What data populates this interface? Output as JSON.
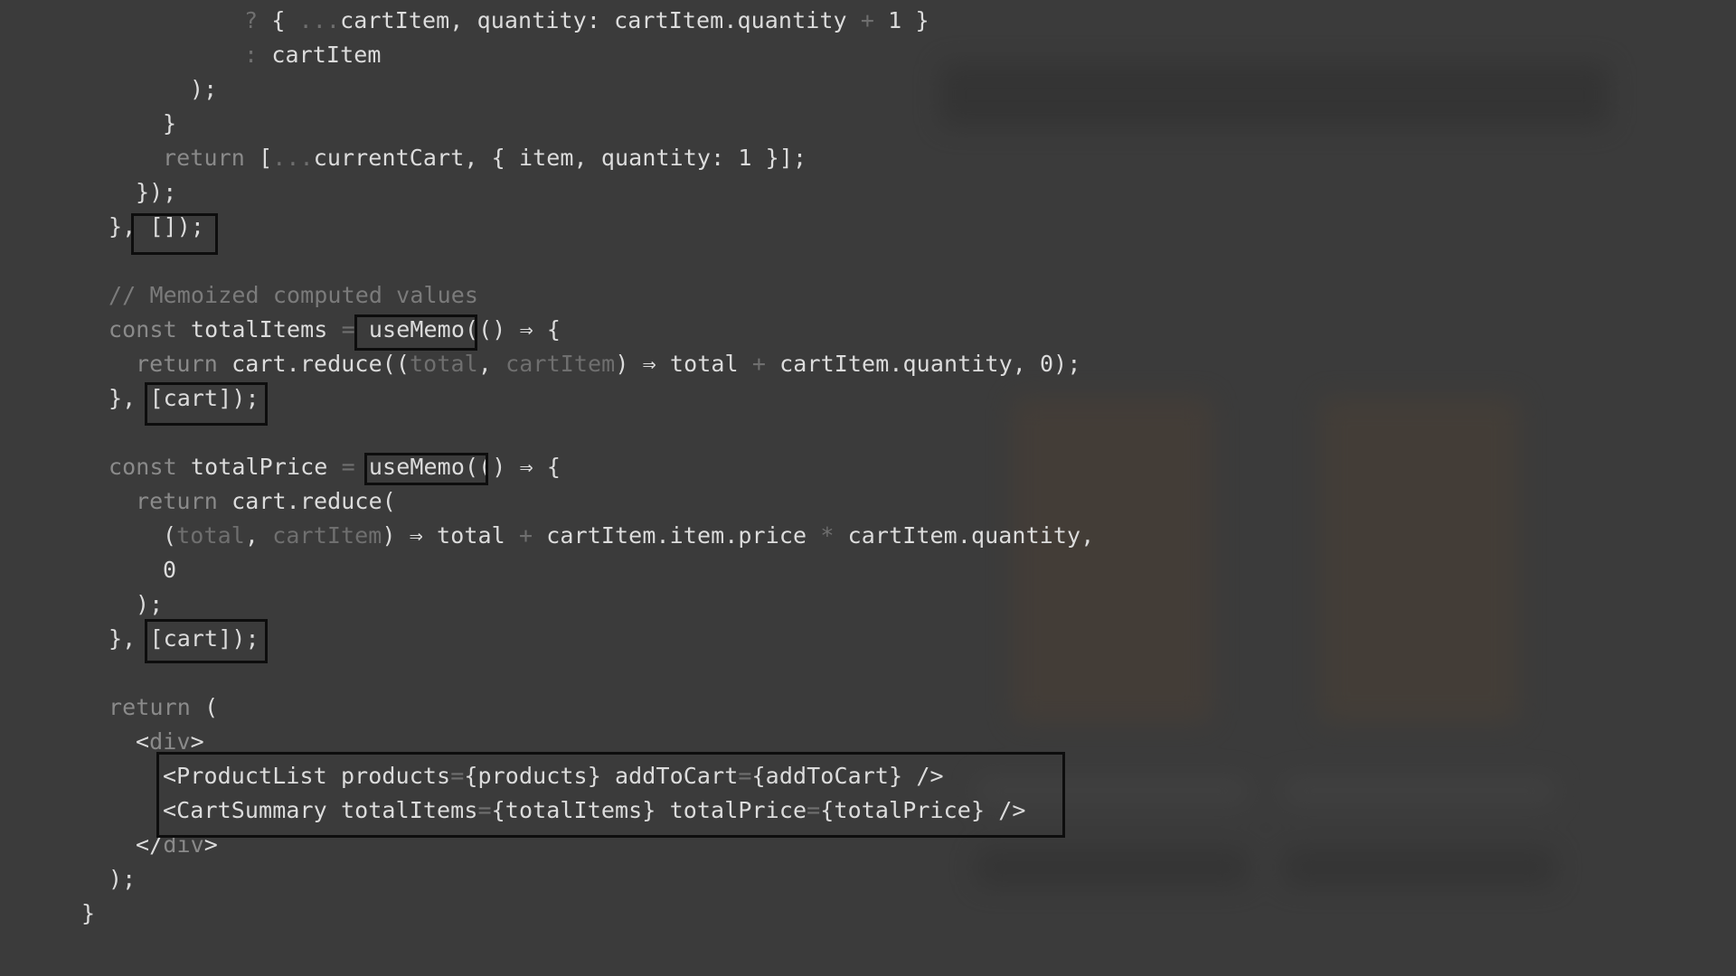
{
  "editor": {
    "language": "jsx",
    "colors": {
      "background": "#3b3b3b",
      "text": "#dcdcdc",
      "keyword": "#8a8a8a",
      "dim": "#6f6f6f",
      "highlight_border": "#0d0d0d"
    },
    "lines": [
      [
        {
          "t": "? ",
          "c": "dim"
        },
        {
          "t": "{ ",
          "c": "txt"
        },
        {
          "t": "...",
          "c": "dim"
        },
        {
          "t": "cartItem, quantity: cartItem.quantity ",
          "c": "txt"
        },
        {
          "t": "+",
          "c": "dim"
        },
        {
          "t": " 1 }",
          "c": "txt"
        }
      ],
      [
        {
          "t": ": ",
          "c": "dim"
        },
        {
          "t": "cartItem",
          "c": "txt"
        }
      ],
      [
        {
          "t": ");",
          "c": "txt"
        }
      ],
      [
        {
          "t": "}",
          "c": "txt"
        }
      ],
      [
        {
          "t": "return ",
          "c": "key"
        },
        {
          "t": "[",
          "c": "txt"
        },
        {
          "t": "...",
          "c": "dim"
        },
        {
          "t": "currentCart, { item, quantity: 1 }];",
          "c": "txt"
        }
      ],
      [
        {
          "t": "});",
          "c": "txt"
        }
      ],
      [
        {
          "t": "}, []);",
          "c": "txt"
        }
      ],
      [],
      [
        {
          "t": "// Memoized computed values",
          "c": "cmt"
        }
      ],
      [
        {
          "t": "const ",
          "c": "key"
        },
        {
          "t": "totalItems ",
          "c": "txt"
        },
        {
          "t": "= ",
          "c": "dim"
        },
        {
          "t": "useMemo(() ⇒ {",
          "c": "txt"
        }
      ],
      [
        {
          "t": "return ",
          "c": "key"
        },
        {
          "t": "cart.reduce((",
          "c": "txt"
        },
        {
          "t": "total",
          "c": "dim"
        },
        {
          "t": ", ",
          "c": "txt"
        },
        {
          "t": "cartItem",
          "c": "dim"
        },
        {
          "t": ") ⇒ total ",
          "c": "txt"
        },
        {
          "t": "+",
          "c": "dim"
        },
        {
          "t": " cartItem.quantity, 0);",
          "c": "txt"
        }
      ],
      [
        {
          "t": "}, [cart]);",
          "c": "txt"
        }
      ],
      [],
      [
        {
          "t": "const ",
          "c": "key"
        },
        {
          "t": "totalPrice ",
          "c": "txt"
        },
        {
          "t": "= ",
          "c": "dim"
        },
        {
          "t": "useMemo(() ⇒ {",
          "c": "txt"
        }
      ],
      [
        {
          "t": "return ",
          "c": "key"
        },
        {
          "t": "cart.reduce(",
          "c": "txt"
        }
      ],
      [
        {
          "t": "(",
          "c": "txt"
        },
        {
          "t": "total",
          "c": "dim"
        },
        {
          "t": ", ",
          "c": "txt"
        },
        {
          "t": "cartItem",
          "c": "dim"
        },
        {
          "t": ") ⇒ total ",
          "c": "txt"
        },
        {
          "t": "+",
          "c": "dim"
        },
        {
          "t": " cartItem.item.price ",
          "c": "txt"
        },
        {
          "t": "*",
          "c": "dim"
        },
        {
          "t": " cartItem.quantity,",
          "c": "txt"
        }
      ],
      [
        {
          "t": "0",
          "c": "txt"
        }
      ],
      [
        {
          "t": ");",
          "c": "txt"
        }
      ],
      [
        {
          "t": "}, [cart]);",
          "c": "txt"
        }
      ],
      [],
      [
        {
          "t": "return ",
          "c": "key"
        },
        {
          "t": "(",
          "c": "txt"
        }
      ],
      [
        {
          "t": "<",
          "c": "txt"
        },
        {
          "t": "div",
          "c": "key"
        },
        {
          "t": ">",
          "c": "txt"
        }
      ],
      [
        {
          "t": "<ProductList products",
          "c": "txt"
        },
        {
          "t": "=",
          "c": "dim"
        },
        {
          "t": "{products} addToCart",
          "c": "txt"
        },
        {
          "t": "=",
          "c": "dim"
        },
        {
          "t": "{addToCart} />",
          "c": "txt"
        }
      ],
      [
        {
          "t": "<CartSummary totalItems",
          "c": "txt"
        },
        {
          "t": "=",
          "c": "dim"
        },
        {
          "t": "{totalItems} totalPrice",
          "c": "txt"
        },
        {
          "t": "=",
          "c": "dim"
        },
        {
          "t": "{totalPrice} />",
          "c": "txt"
        }
      ],
      [
        {
          "t": "</",
          "c": "txt"
        },
        {
          "t": "div",
          "c": "key"
        },
        {
          "t": ">",
          "c": "txt"
        }
      ],
      [
        {
          "t": ");",
          "c": "txt"
        }
      ],
      [
        {
          "t": "}",
          "c": "txt"
        }
      ]
    ]
  }
}
